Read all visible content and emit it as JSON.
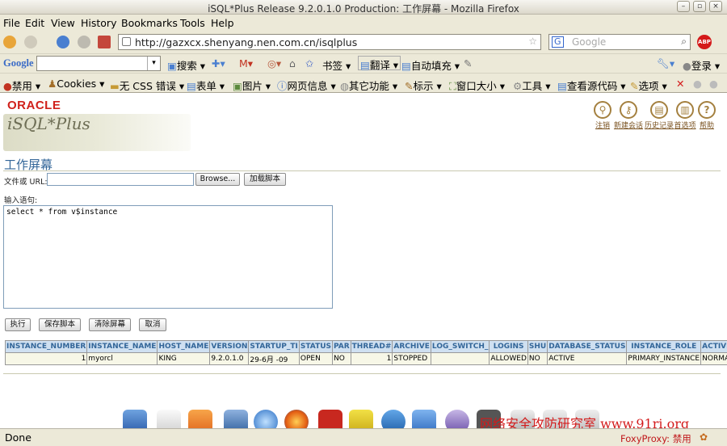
{
  "window": {
    "title": "iSQL*Plus Release 9.2.0.1.0 Production: 工作屏幕 - Mozilla Firefox"
  },
  "menu": [
    "File",
    "Edit",
    "View",
    "History",
    "Bookmarks",
    "Tools",
    "Help"
  ],
  "nav": {
    "url": "http://gazxcx.shenyang.nen.com.cn/isqlplus",
    "search_placeholder": "Google",
    "abp": "ABP"
  },
  "google_toolbar": {
    "logo": "Google",
    "items": [
      "搜索",
      "书签",
      "翻译",
      "自动填充",
      "登录"
    ]
  },
  "webdev_toolbar": {
    "items": [
      "禁用",
      "Cookies",
      "无 CSS",
      "错误",
      "表单",
      "图片",
      "网页信息",
      "其它功能",
      "标示",
      "窗口大小",
      "工具",
      "查看源代码",
      "选项"
    ]
  },
  "page": {
    "oracle_logo": "ORACLE",
    "product": "iSQL*Plus",
    "top_actions": [
      "注销",
      "新建会话",
      "历史记录",
      "首选项",
      "帮助"
    ],
    "title": "工作屏幕",
    "file_url_label": "文件或 URL:",
    "file_url_value": "",
    "browse_button": "Browse...",
    "load_script_button": "加载脚本",
    "input_label": "输入语句:",
    "sql_text": "select * from v$instance",
    "buttons": [
      "执行",
      "保存脚本",
      "清除屏幕",
      "取消"
    ]
  },
  "result_table": {
    "columns": [
      "INSTANCE_NUMBER",
      "INSTANCE_NAME",
      "HOST_NAME",
      "VERSION",
      "STARTUP_TI",
      "STATUS",
      "PAR",
      "THREAD#",
      "ARCHIVE",
      "LOG_SWITCH_",
      "LOGINS",
      "SHU",
      "DATABASE_STATUS",
      "INSTANCE_ROLE",
      "ACTIVE_ST"
    ],
    "rows": [
      [
        "1",
        "myorcl",
        "KING",
        "9.2.0.1.0",
        "29-6月 -09",
        "OPEN",
        "NO",
        "1",
        "STOPPED",
        "",
        "ALLOWED",
        "NO",
        "ACTIVE",
        "PRIMARY_INSTANCE",
        "NORMAL"
      ]
    ]
  },
  "watermark": "网络安全攻防研究室 www.91ri.org",
  "status": {
    "text": "Done",
    "foxyproxy": "FoxyProxy: 禁用"
  }
}
